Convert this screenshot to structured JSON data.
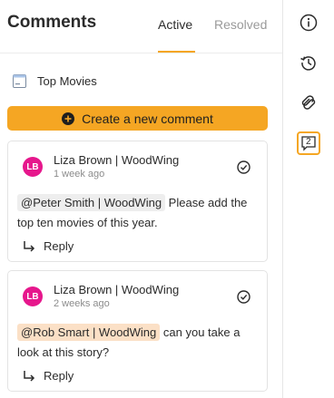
{
  "header": {
    "title": "Comments",
    "tabs": [
      {
        "label": "Active",
        "active": true
      },
      {
        "label": "Resolved",
        "active": false
      }
    ]
  },
  "document": {
    "label": "Top Movies",
    "icon": "document-icon"
  },
  "create_button": {
    "label": "Create a new comment",
    "icon": "plus-circle-icon"
  },
  "comments": [
    {
      "avatar_initials": "LB",
      "author": "Liza Brown | WoodWing",
      "time": "1 week ago",
      "mention": "@Peter Smith | WoodWing",
      "text": " Please add the top ten movies of this year.",
      "reply_label": "Reply"
    },
    {
      "avatar_initials": "LB",
      "author": "Liza Brown | WoodWing",
      "time": "2 weeks ago",
      "mention": "@Rob Smart | WoodWing",
      "text": " can you take a look at this story?",
      "reply_label": "Reply"
    }
  ],
  "rail": {
    "items": [
      {
        "icon": "info-icon"
      },
      {
        "icon": "history-icon"
      },
      {
        "icon": "link-icon"
      },
      {
        "icon": "comments-icon",
        "count": "2",
        "active": true
      }
    ]
  },
  "colors": {
    "accent": "#f5a623",
    "avatar": "#e6178c",
    "mention_grey": "#eeeeee",
    "mention_peach": "#fbe0c6"
  }
}
